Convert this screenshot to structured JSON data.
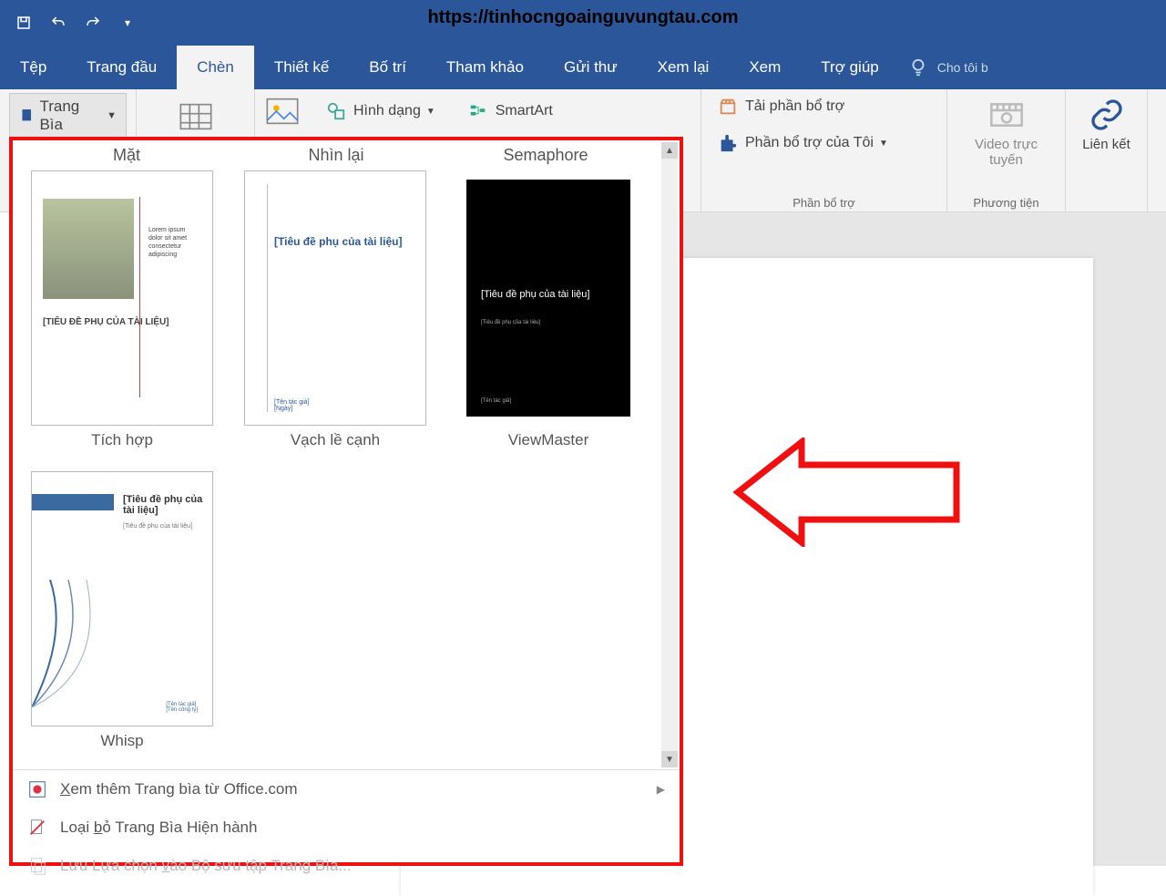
{
  "watermark_url": "https://tinhocngoainguvungtau.com",
  "tabs": [
    "Tệp",
    "Trang đầu",
    "Chèn",
    "Thiết kế",
    "Bố trí",
    "Tham khảo",
    "Gửi thư",
    "Xem lại",
    "Xem",
    "Trợ giúp"
  ],
  "active_tab_index": 2,
  "tell_me": "Cho tôi b",
  "ribbon": {
    "trang_bia": "Trang Bìa",
    "hinh_dang": "Hình dạng",
    "smartart": "SmartArt",
    "addins_label": "Phần bổ trợ",
    "get_addins": "Tải phần bổ trợ",
    "my_addins": "Phần bổ trợ của Tôi",
    "media_label": "Phương tiện",
    "online_video": "Video trực tuyến",
    "link": "Liên kết"
  },
  "gallery": {
    "row1_heads": [
      "Mặt",
      "Nhìn lại",
      "Semaphore"
    ],
    "row1_caps": [
      "Tích hợp",
      "Vạch lề cạnh",
      "ViewMaster"
    ],
    "row2_caps": [
      "Whisp"
    ],
    "thumb_subtitle1": "[TIÊU ĐỀ PHỤ CỦA TÀI LIỆU]",
    "thumb_subtitle2": "[Tiêu đề phụ của tài liệu]",
    "thumb_subtitle3": "[Tiêu đề phụ của tài liệu]",
    "thumb_subtitle3b": "[Tiêu đề phụ của tài liệu]",
    "thumb_subtitle4": "[Tiêu đề phụ của tài liệu]",
    "thumb4_sub": "[Tiêu đề phụ của tài liệu]",
    "menu": {
      "more": "Xem thêm Trang bìa từ Office.com",
      "remove": "Loại bỏ Trang Bìa Hiện hành",
      "save": "Lưu Lựa chọn vào Bộ sưu tập Trang Bìa...",
      "more_u": "X",
      "remove_u": "b",
      "save_u": "v"
    }
  }
}
